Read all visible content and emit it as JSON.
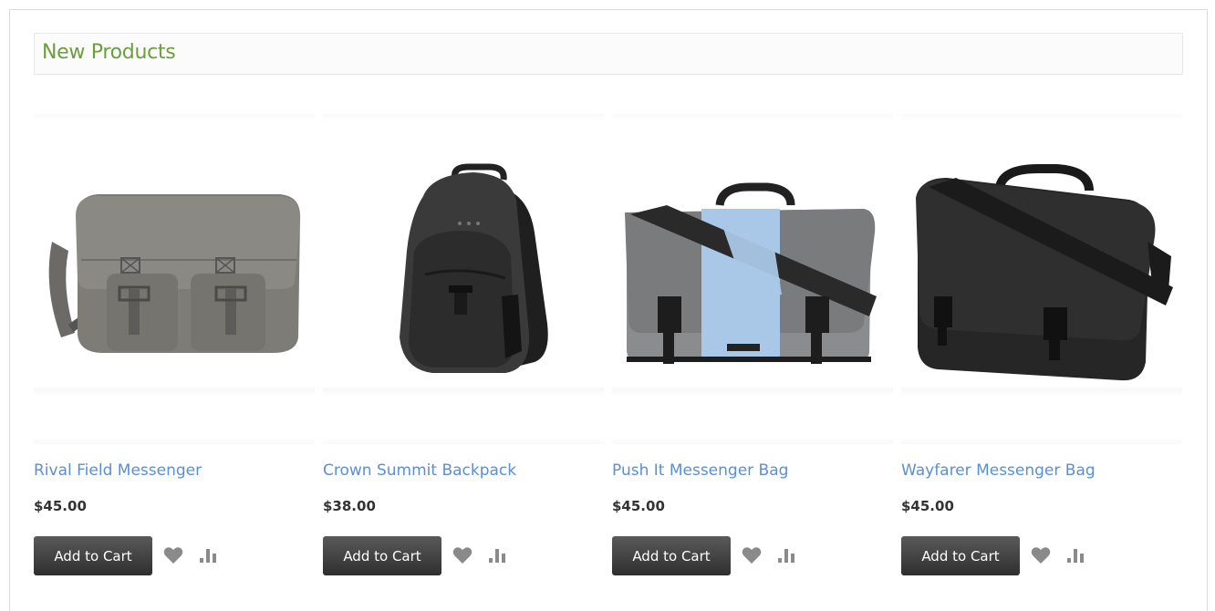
{
  "widget": {
    "title": "New Products"
  },
  "products": [
    {
      "name": "Rival Field Messenger",
      "price": "$45.00",
      "add_to_cart": "Add to Cart",
      "image": "olive-gray-messenger-bag"
    },
    {
      "name": "Crown Summit Backpack",
      "price": "$38.00",
      "add_to_cart": "Add to Cart",
      "image": "black-backpack"
    },
    {
      "name": "Push It Messenger Bag",
      "price": "$45.00",
      "add_to_cart": "Add to Cart",
      "image": "gray-blue-messenger-bag"
    },
    {
      "name": "Wayfarer Messenger Bag",
      "price": "$45.00",
      "add_to_cart": "Add to Cart",
      "image": "black-messenger-bag"
    }
  ],
  "icons": {
    "wishlist": "heart-icon",
    "compare": "compare-bars-icon"
  },
  "colors": {
    "title": "#6a9f3c",
    "product_link": "#5b8fd1",
    "button": "#3f3f3f",
    "icon": "#8a8a8a"
  }
}
